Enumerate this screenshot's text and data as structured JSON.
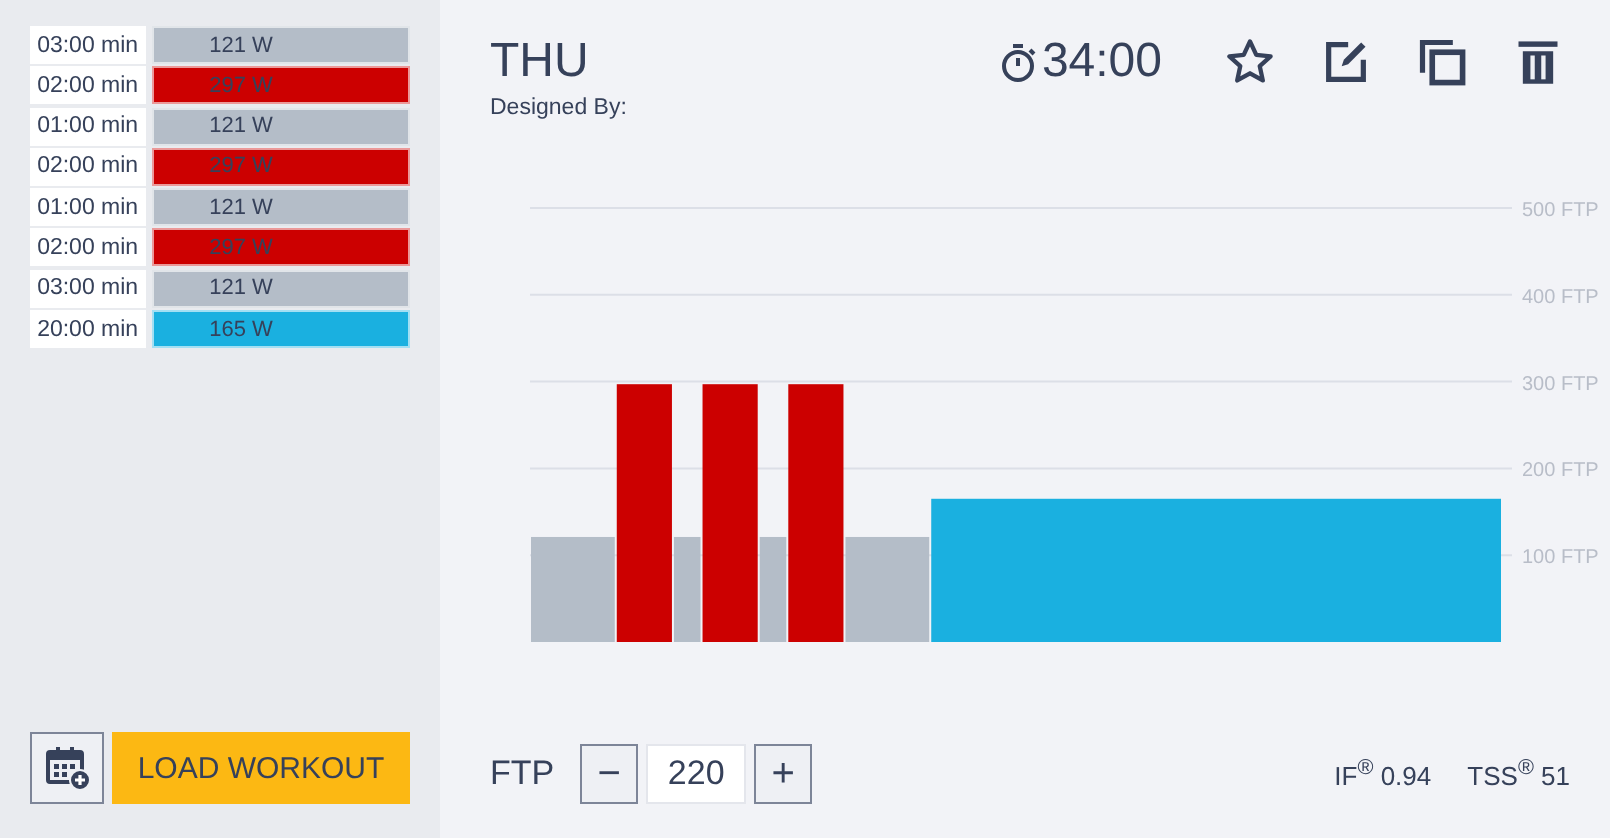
{
  "intervals": [
    {
      "duration": "03:00 min",
      "power": "121 W",
      "color": "#b4bdc8"
    },
    {
      "duration": "02:00 min",
      "power": "297 W",
      "color": "#cc0000"
    },
    {
      "duration": "01:00 min",
      "power": "121 W",
      "color": "#b4bdc8"
    },
    {
      "duration": "02:00 min",
      "power": "297 W",
      "color": "#cc0000"
    },
    {
      "duration": "01:00 min",
      "power": "121 W",
      "color": "#b4bdc8"
    },
    {
      "duration": "02:00 min",
      "power": "297 W",
      "color": "#cc0000"
    },
    {
      "duration": "03:00 min",
      "power": "121 W",
      "color": "#b4bdc8"
    },
    {
      "duration": "20:00 min",
      "power": "165 W",
      "color": "#1ab0e0"
    }
  ],
  "load_button": "LOAD WORKOUT",
  "workout": {
    "title": "THU",
    "designer_label": "Designed By:",
    "duration": "34:00"
  },
  "profile": {
    "kind": "picture",
    "axis_labels": [
      "500 FTP",
      "400 FTP",
      "300 FTP",
      "200 FTP",
      "100 FTP"
    ]
  },
  "ftp": {
    "label": "FTP",
    "minus": "−",
    "value": "220",
    "plus": "+"
  },
  "stats": [
    {
      "label": "IF",
      "mark": "®",
      "value": "0.94"
    },
    {
      "label": "TSS",
      "mark": "®",
      "value": "51"
    }
  ]
}
